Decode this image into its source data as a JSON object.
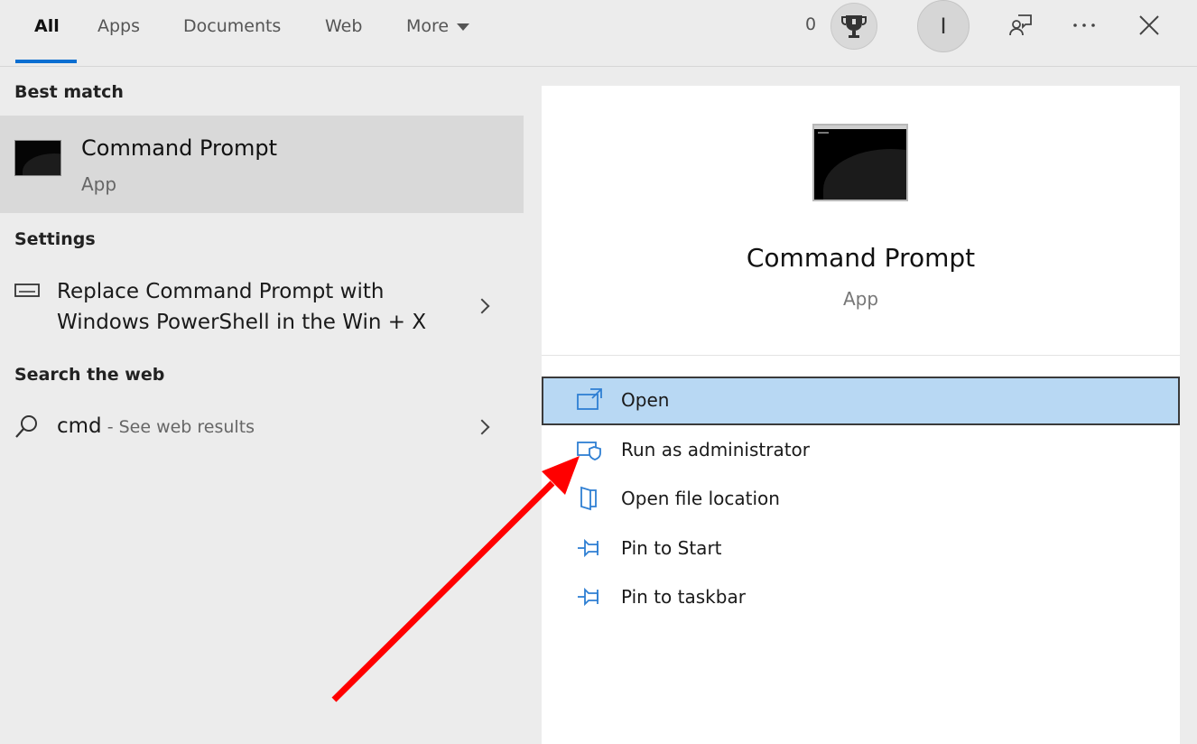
{
  "tabs": [
    {
      "label": "All",
      "active": true
    },
    {
      "label": "Apps"
    },
    {
      "label": "Documents"
    },
    {
      "label": "Web"
    },
    {
      "label": "More"
    }
  ],
  "header": {
    "points": "0",
    "avatar_initial": "I",
    "icons": [
      "trophy-icon",
      "feedback-icon",
      "more-options-icon",
      "close-icon"
    ]
  },
  "left": {
    "best_match_title": "Best match",
    "best_match": {
      "title": "Command Prompt",
      "subtitle": "App",
      "icon": "command-prompt-icon"
    },
    "settings_title": "Settings",
    "settings_item": {
      "line1": "Replace Command Prompt with",
      "line2": "Windows PowerShell in the Win + X",
      "icon": "keyboard-icon"
    },
    "web_title": "Search the web",
    "web_item": {
      "query": "cmd",
      "suffix": " - See web results",
      "icon": "search-icon"
    }
  },
  "right": {
    "app_title": "Command Prompt",
    "app_subtitle": "App",
    "actions": [
      {
        "label": "Open",
        "icon": "open-icon",
        "selected": true
      },
      {
        "label": "Run as administrator",
        "icon": "shield-admin-icon"
      },
      {
        "label": "Open file location",
        "icon": "folder-location-icon"
      },
      {
        "label": "Pin to Start",
        "icon": "pin-icon"
      },
      {
        "label": "Pin to taskbar",
        "icon": "pin-icon"
      }
    ]
  },
  "colors": {
    "accent": "#0a6ed1",
    "selected_bg": "#b8d8f3",
    "annotation_arrow": "#ff0000",
    "icon_blue": "#2f7fd3"
  }
}
